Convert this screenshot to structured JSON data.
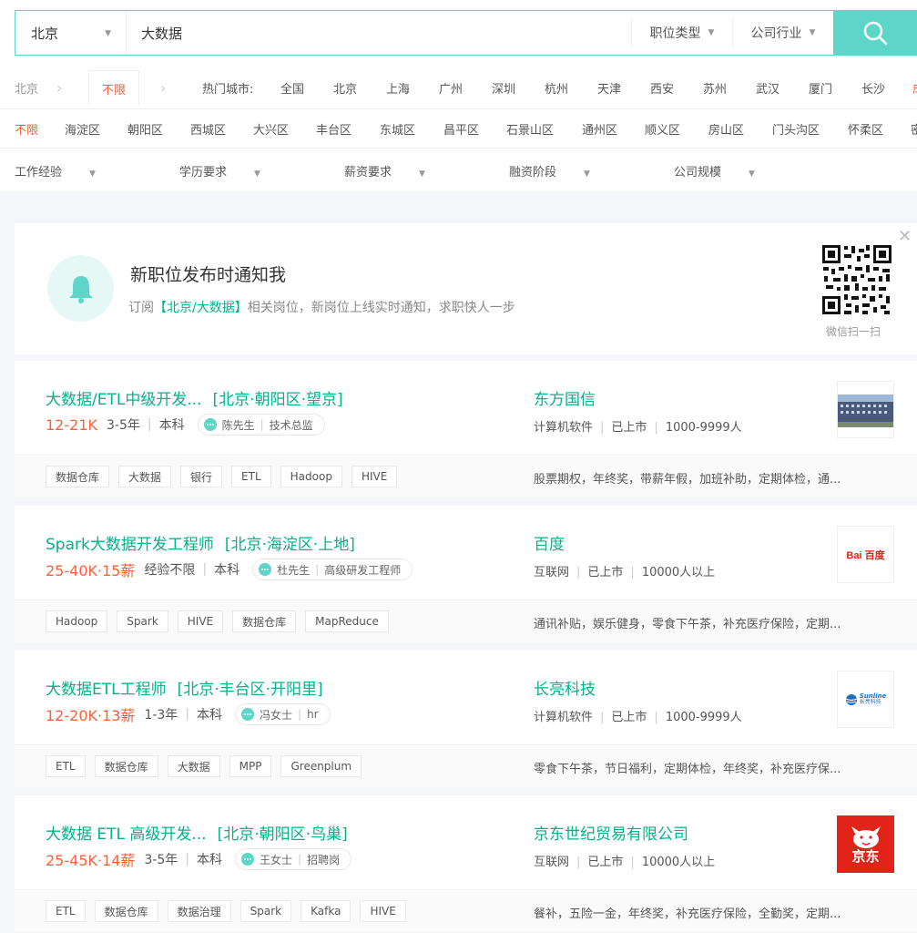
{
  "search": {
    "city": "北京",
    "query": "大数据",
    "job_type": "职位类型",
    "industry": "公司行业"
  },
  "filters": {
    "crumb_city": "北京",
    "nolimit": "不限",
    "hot_label": "热门城市:",
    "hot_cities": [
      "全国",
      "北京",
      "上海",
      "广州",
      "深圳",
      "杭州",
      "天津",
      "西安",
      "苏州",
      "武汉",
      "厦门",
      "长沙",
      "成"
    ],
    "district_nolimit": "不限",
    "districts": [
      "海淀区",
      "朝阳区",
      "西城区",
      "大兴区",
      "丰台区",
      "东城区",
      "昌平区",
      "石景山区",
      "通州区",
      "顺义区",
      "房山区",
      "门头沟区",
      "怀柔区",
      "密"
    ],
    "dropdowns": [
      "工作经验",
      "学历要求",
      "薪资要求",
      "融资阶段",
      "公司规模"
    ]
  },
  "notify": {
    "title": "新职位发布时通知我",
    "sub_prefix": "订阅",
    "sub_highlight": "【北京/大数据】",
    "sub_suffix": "相关岗位，新岗位上线实时通知，求职快人一步",
    "qr_label": "微信扫一扫"
  },
  "jobs": [
    {
      "title": "大数据/ETL中级开发...",
      "location": "[北京·朝阳区·望京]",
      "salary": "12-21K",
      "experience": "3-5年",
      "education": "本科",
      "hr_name": "陈先生",
      "hr_title": "技术总监",
      "company": "东方国信",
      "industry": "计算机软件",
      "stage": "已上市",
      "size": "1000-9999人",
      "tags": [
        "数据仓库",
        "大数据",
        "银行",
        "ETL",
        "Hadoop",
        "HIVE"
      ],
      "benefits": "股票期权，年终奖，带薪年假，加班补助，定期体检，通..."
    },
    {
      "title": "Spark大数据开发工程师",
      "location": "[北京·海淀区·上地]",
      "salary": "25-40K·15薪",
      "experience": "经验不限",
      "education": "本科",
      "hr_name": "杜先生",
      "hr_title": "高级研发工程师",
      "company": "百度",
      "industry": "互联网",
      "stage": "已上市",
      "size": "10000人以上",
      "tags": [
        "Hadoop",
        "Spark",
        "HIVE",
        "数据仓库",
        "MapReduce"
      ],
      "benefits": "通讯补贴，娱乐健身，零食下午茶，补充医疗保险，定期..."
    },
    {
      "title": "大数据ETL工程师",
      "location": "[北京·丰台区·开阳里]",
      "salary": "12-20K·13薪",
      "experience": "1-3年",
      "education": "本科",
      "hr_name": "冯女士",
      "hr_title": "hr",
      "company": "长亮科技",
      "industry": "计算机软件",
      "stage": "已上市",
      "size": "1000-9999人",
      "tags": [
        "ETL",
        "数据仓库",
        "大数据",
        "MPP",
        "Greenplum"
      ],
      "benefits": "零食下午茶，节日福利，定期体检，年终奖，补充医疗保..."
    },
    {
      "title": "大数据 ETL 高级开发...",
      "location": "[北京·朝阳区·鸟巢]",
      "salary": "25-45K·14薪",
      "experience": "3-5年",
      "education": "本科",
      "hr_name": "王女士",
      "hr_title": "招聘岗",
      "company": "京东世纪贸易有限公司",
      "industry": "互联网",
      "stage": "已上市",
      "size": "10000人以上",
      "tags": [
        "ETL",
        "数据仓库",
        "数据治理",
        "Spark",
        "Kafka",
        "HIVE"
      ],
      "benefits": "餐补，五险一金，年终奖，补充医疗保险，全勤奖，定期..."
    }
  ],
  "logos": {
    "baidu": "Bai 百度",
    "sunline": "Sunline",
    "sunline_cn": "长亮科技",
    "jd": "京东"
  },
  "colors": {
    "accent": "#00b38a",
    "search_border": "#5dd5c8",
    "salary": "#fd5f39"
  }
}
